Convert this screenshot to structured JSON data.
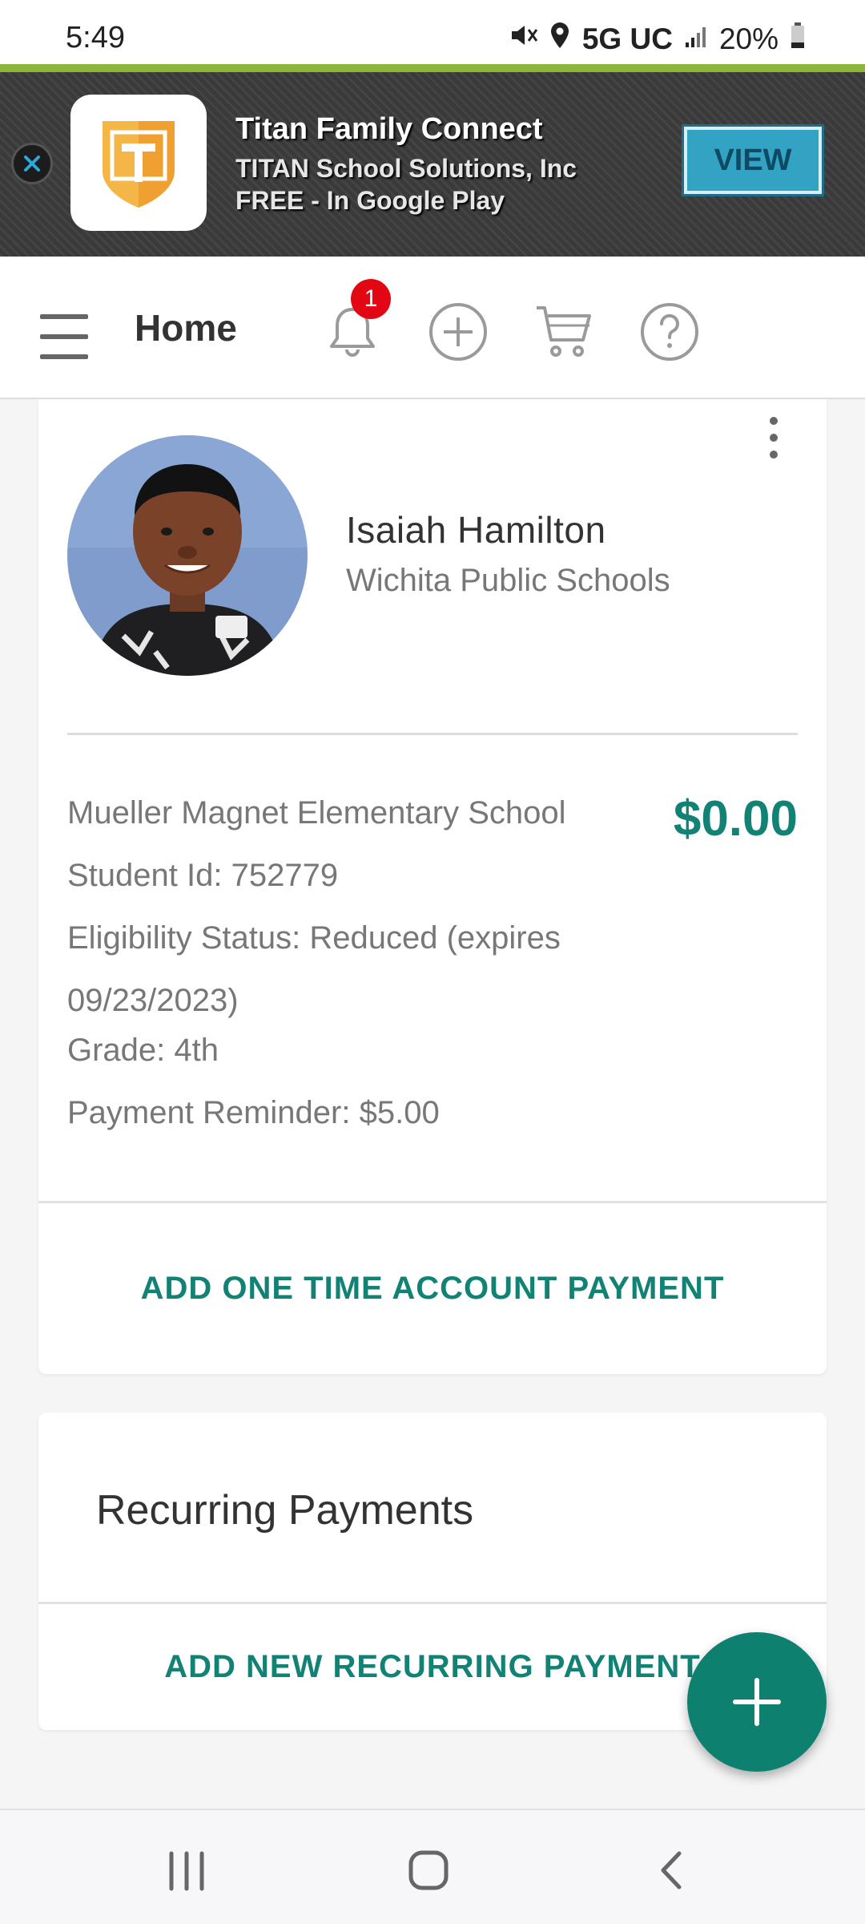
{
  "status_bar": {
    "time": "5:49",
    "network": "5G UC",
    "battery": "20%"
  },
  "ad_banner": {
    "app_name": "Titan Family Connect",
    "publisher": "TITAN School Solutions, Inc",
    "price_store": "FREE - In Google Play",
    "view_label": "VIEW",
    "logo_letter": "T",
    "logo_color": "#f0a030"
  },
  "top_nav": {
    "title": "Home",
    "notification_count": "1"
  },
  "student": {
    "name": "Isaiah Hamilton",
    "district": "Wichita Public Schools",
    "school": "Mueller Magnet Elementary School",
    "balance": "$0.00",
    "student_id": "Student Id: 752779",
    "eligibility_line1": "Eligibility Status: Reduced (expires",
    "eligibility_line2": "09/23/2023)",
    "grade": "Grade: 4th",
    "payment_reminder": "Payment Reminder: $5.00",
    "one_time_payment_label": "ADD ONE TIME ACCOUNT PAYMENT"
  },
  "recurring": {
    "title": "Recurring Payments",
    "add_label": "ADD NEW RECURRING PAYMENT"
  },
  "colors": {
    "accent": "#128275",
    "fab": "#0d8070",
    "badge": "#e30613",
    "ad_button": "#33a3c4"
  }
}
